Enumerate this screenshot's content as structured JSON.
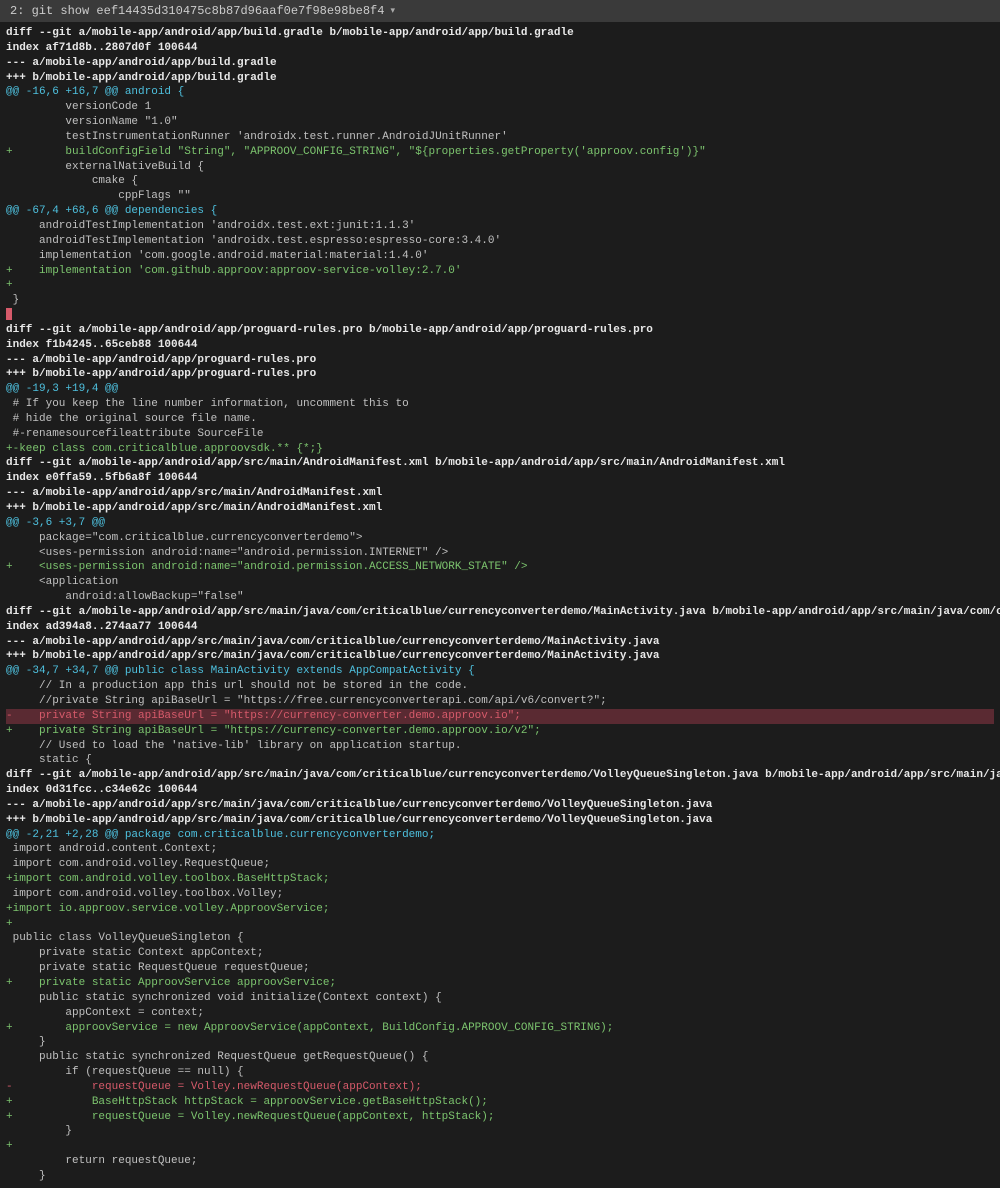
{
  "titleBar": {
    "label": "2: git show eef14435d310475c8b87d96aaf0e7f98e98be8f4",
    "dropdown": "▾"
  },
  "lines": [
    {
      "cls": "white bold",
      "text": "diff --git a/mobile-app/android/app/build.gradle b/mobile-app/android/app/build.gradle"
    },
    {
      "cls": "white bold",
      "text": "index af71d8b..2807d0f 100644"
    },
    {
      "cls": "white bold",
      "text": "--- a/mobile-app/android/app/build.gradle"
    },
    {
      "cls": "white bold",
      "text": "+++ b/mobile-app/android/app/build.gradle"
    },
    {
      "cls": "hunk",
      "text": "@@ -16,6 +16,7 @@ android {"
    },
    {
      "cls": "ctx",
      "text": "         versionCode 1"
    },
    {
      "cls": "ctx",
      "text": "         versionName \"1.0\""
    },
    {
      "cls": "ctx",
      "text": "         testInstrumentationRunner 'androidx.test.runner.AndroidJUnitRunner'"
    },
    {
      "cls": "add",
      "text": "+        buildConfigField \"String\", \"APPROOV_CONFIG_STRING\", \"${properties.getProperty('approov.config')}\""
    },
    {
      "cls": "ctx",
      "text": "         externalNativeBuild {"
    },
    {
      "cls": "ctx",
      "text": "             cmake {"
    },
    {
      "cls": "ctx",
      "text": "                 cppFlags \"\""
    },
    {
      "cls": "hunk",
      "text": "@@ -67,4 +68,6 @@ dependencies {"
    },
    {
      "cls": "ctx",
      "text": "     androidTestImplementation 'androidx.test.ext:junit:1.1.3'"
    },
    {
      "cls": "ctx",
      "text": "     androidTestImplementation 'androidx.test.espresso:espresso-core:3.4.0'"
    },
    {
      "cls": "ctx",
      "text": "     implementation 'com.google.android.material:material:1.4.0'"
    },
    {
      "cls": "add",
      "text": "+    implementation 'com.github.approov:approov-service-volley:2.7.0'"
    },
    {
      "cls": "add",
      "text": "+"
    },
    {
      "cls": "ctx",
      "text": " }"
    },
    {
      "cls": "bg-red-small",
      "text": " "
    },
    {
      "cls": "white bold",
      "text": "diff --git a/mobile-app/android/app/proguard-rules.pro b/mobile-app/android/app/proguard-rules.pro"
    },
    {
      "cls": "white bold",
      "text": "index f1b4245..65ceb88 100644"
    },
    {
      "cls": "white bold",
      "text": "--- a/mobile-app/android/app/proguard-rules.pro"
    },
    {
      "cls": "white bold",
      "text": "+++ b/mobile-app/android/app/proguard-rules.pro"
    },
    {
      "cls": "hunk",
      "text": "@@ -19,3 +19,4 @@"
    },
    {
      "cls": "ctx",
      "text": " # If you keep the line number information, uncomment this to"
    },
    {
      "cls": "ctx",
      "text": " # hide the original source file name."
    },
    {
      "cls": "ctx",
      "text": " #-renamesourcefileattribute SourceFile"
    },
    {
      "cls": "add",
      "text": "+-keep class com.criticalblue.approovsdk.** {*;}"
    },
    {
      "cls": "white bold",
      "text": "diff --git a/mobile-app/android/app/src/main/AndroidManifest.xml b/mobile-app/android/app/src/main/AndroidManifest.xml"
    },
    {
      "cls": "white bold",
      "text": "index e0ffa59..5fb6a8f 100644"
    },
    {
      "cls": "white bold",
      "text": "--- a/mobile-app/android/app/src/main/AndroidManifest.xml"
    },
    {
      "cls": "white bold",
      "text": "+++ b/mobile-app/android/app/src/main/AndroidManifest.xml"
    },
    {
      "cls": "hunk",
      "text": "@@ -3,6 +3,7 @@"
    },
    {
      "cls": "ctx",
      "text": "     package=\"com.criticalblue.currencyconverterdemo\">"
    },
    {
      "cls": "ctx",
      "text": ""
    },
    {
      "cls": "ctx",
      "text": "     <uses-permission android:name=\"android.permission.INTERNET\" />"
    },
    {
      "cls": "add",
      "text": "+    <uses-permission android:name=\"android.permission.ACCESS_NETWORK_STATE\" />"
    },
    {
      "cls": "ctx",
      "text": ""
    },
    {
      "cls": "ctx",
      "text": "     <application"
    },
    {
      "cls": "ctx",
      "text": "         android:allowBackup=\"false\""
    },
    {
      "cls": "white bold",
      "text": "diff --git a/mobile-app/android/app/src/main/java/com/criticalblue/currencyconverterdemo/MainActivity.java b/mobile-app/android/app/src/main/java/com/criticalblue/currencyconverterdemo/MainActivity.java"
    },
    {
      "cls": "white bold",
      "text": "index ad394a8..274aa77 100644"
    },
    {
      "cls": "white bold",
      "text": "--- a/mobile-app/android/app/src/main/java/com/criticalblue/currencyconverterdemo/MainActivity.java"
    },
    {
      "cls": "white bold",
      "text": "+++ b/mobile-app/android/app/src/main/java/com/criticalblue/currencyconverterdemo/MainActivity.java"
    },
    {
      "cls": "hunk",
      "text": "@@ -34,7 +34,7 @@ public class MainActivity extends AppCompatActivity {"
    },
    {
      "cls": "ctx",
      "text": ""
    },
    {
      "cls": "ctx",
      "text": "     // In a production app this url should not be stored in the code."
    },
    {
      "cls": "ctx",
      "text": "     //private String apiBaseUrl = \"https://free.currencyconverterapi.com/api/v6/convert?\";"
    },
    {
      "cls": "del-hl",
      "text": "-    private String apiBaseUrl = \"https://currency-converter.demo.approov.io\";"
    },
    {
      "cls": "add",
      "text": "+    private String apiBaseUrl = \"https://currency-converter.demo.approov.io/v2\";"
    },
    {
      "cls": "ctx",
      "text": ""
    },
    {
      "cls": "ctx",
      "text": "     // Used to load the 'native-lib' library on application startup."
    },
    {
      "cls": "ctx",
      "text": "     static {"
    },
    {
      "cls": "white bold",
      "text": "diff --git a/mobile-app/android/app/src/main/java/com/criticalblue/currencyconverterdemo/VolleyQueueSingleton.java b/mobile-app/android/app/src/main/java/com/criticalblue/currencyconverterdemo/VolleyQueueSingleton.java"
    },
    {
      "cls": "white bold",
      "text": "index 0d31fcc..c34e62c 100644"
    },
    {
      "cls": "white bold",
      "text": "--- a/mobile-app/android/app/src/main/java/com/criticalblue/currencyconverterdemo/VolleyQueueSingleton.java"
    },
    {
      "cls": "white bold",
      "text": "+++ b/mobile-app/android/app/src/main/java/com/criticalblue/currencyconverterdemo/VolleyQueueSingleton.java"
    },
    {
      "cls": "hunk",
      "text": "@@ -2,21 +2,28 @@ package com.criticalblue.currencyconverterdemo;"
    },
    {
      "cls": "ctx",
      "text": ""
    },
    {
      "cls": "ctx",
      "text": " import android.content.Context;"
    },
    {
      "cls": "ctx",
      "text": " import com.android.volley.RequestQueue;"
    },
    {
      "cls": "add",
      "text": "+import com.android.volley.toolbox.BaseHttpStack;"
    },
    {
      "cls": "ctx",
      "text": " import com.android.volley.toolbox.Volley;"
    },
    {
      "cls": "ctx",
      "text": ""
    },
    {
      "cls": "add",
      "text": "+import io.approov.service.volley.ApproovService;"
    },
    {
      "cls": "add",
      "text": "+"
    },
    {
      "cls": "ctx",
      "text": " public class VolleyQueueSingleton {"
    },
    {
      "cls": "ctx",
      "text": "     private static Context appContext;"
    },
    {
      "cls": "ctx",
      "text": ""
    },
    {
      "cls": "ctx",
      "text": "     private static RequestQueue requestQueue;"
    },
    {
      "cls": "add",
      "text": "+    private static ApproovService approovService;"
    },
    {
      "cls": "ctx",
      "text": ""
    },
    {
      "cls": "ctx",
      "text": "     public static synchronized void initialize(Context context) {"
    },
    {
      "cls": "ctx",
      "text": "         appContext = context;"
    },
    {
      "cls": "add",
      "text": "+        approovService = new ApproovService(appContext, BuildConfig.APPROOV_CONFIG_STRING);"
    },
    {
      "cls": "ctx",
      "text": "     }"
    },
    {
      "cls": "ctx",
      "text": ""
    },
    {
      "cls": "ctx",
      "text": "     public static synchronized RequestQueue getRequestQueue() {"
    },
    {
      "cls": "ctx",
      "text": "         if (requestQueue == null) {"
    },
    {
      "cls": "del",
      "text": "-            requestQueue = Volley.newRequestQueue(appContext);"
    },
    {
      "cls": "add",
      "text": "+            BaseHttpStack httpStack = approovService.getBaseHttpStack();"
    },
    {
      "cls": "add",
      "text": "+            requestQueue = Volley.newRequestQueue(appContext, httpStack);"
    },
    {
      "cls": "ctx",
      "text": "         }"
    },
    {
      "cls": "add",
      "text": "+"
    },
    {
      "cls": "ctx",
      "text": "         return requestQueue;"
    },
    {
      "cls": "ctx",
      "text": "     }"
    }
  ]
}
